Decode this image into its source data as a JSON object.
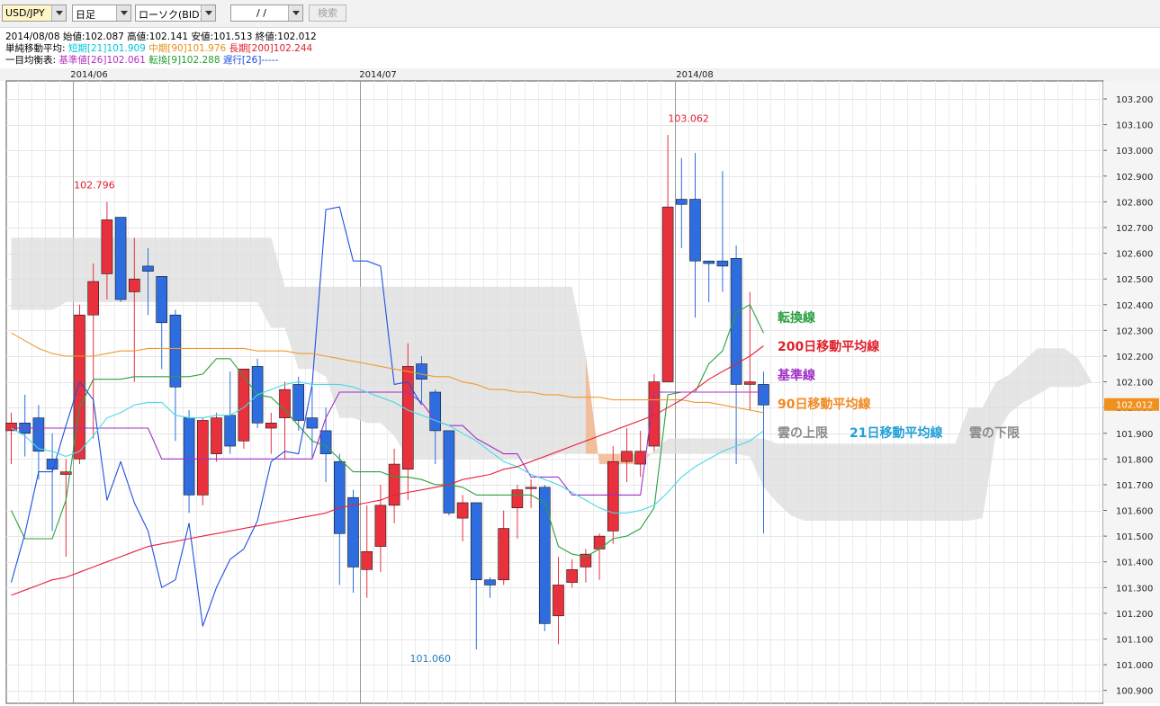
{
  "toolbar": {
    "pair": "USD/JPY",
    "timeframe": "日足",
    "chart_type": "ローソク(BID)",
    "date_input": "/ /",
    "search_label": "検索"
  },
  "info": {
    "ohlc": "2014/08/08  始値:102.087  高値:102.141  安値:101.513  終値:102.012",
    "sma_label": "単純移動平均:",
    "sma_short": "短期[21]101.909",
    "sma_mid": "中期[90]101.976",
    "sma_long": "長期[200]102.244",
    "ichimoku_label": "一目均衡表:",
    "kijun": "基準値[26]102.061",
    "tenkan": "転換[9]102.288",
    "chikou": "遅行[26]-----"
  },
  "legend": {
    "tenkan": "転換線",
    "ma200": "200日移動平均線",
    "kijun": "基準線",
    "ma90": "90日移動平均線",
    "cloud_upper": "雲の上限",
    "ma21": "21日移動平均線",
    "cloud_lower": "雲の下限"
  },
  "colors": {
    "up": "#e8313d",
    "down": "#2d6de0",
    "tenkan": "#2ca040",
    "kijun": "#a030c8",
    "chikou": "#2050e0",
    "ma21": "#4ad8e8",
    "ma90": "#f09a30",
    "ma200": "#e8203c",
    "cloud": "#dcdcdc",
    "cloud_bull": "#f2b48a",
    "last_price_bg": "#f0901e"
  },
  "chart_data": {
    "type": "candlestick",
    "title": "",
    "ylim": [
      100.85,
      103.27
    ],
    "y_ticks": [
      "103.200",
      "103.100",
      "103.000",
      "102.900",
      "102.800",
      "102.700",
      "102.600",
      "102.500",
      "102.400",
      "102.300",
      "102.200",
      "102.100",
      "102.000",
      "101.900",
      "101.800",
      "101.700",
      "101.600",
      "101.500",
      "101.400",
      "101.300",
      "101.200",
      "101.100",
      "101.000",
      "100.900"
    ],
    "x_labels": [
      "2014/06",
      "2014/07",
      "2014/08"
    ],
    "last_price": "102.012",
    "annotations": [
      {
        "label": "102.796",
        "value": 102.796
      },
      {
        "label": "103.062",
        "value": 103.062
      },
      {
        "label": "101.060",
        "value": 101.06
      }
    ],
    "candles": [
      {
        "o": 101.91,
        "h": 101.98,
        "l": 101.78,
        "c": 101.94
      },
      {
        "o": 101.94,
        "h": 102.05,
        "l": 101.81,
        "c": 101.9
      },
      {
        "o": 101.96,
        "h": 102.01,
        "l": 101.72,
        "c": 101.83
      },
      {
        "o": 101.8,
        "h": 101.9,
        "l": 101.52,
        "c": 101.76
      },
      {
        "o": 101.74,
        "h": 101.8,
        "l": 101.42,
        "c": 101.75
      },
      {
        "o": 101.8,
        "h": 102.4,
        "l": 101.78,
        "c": 102.36
      },
      {
        "o": 102.36,
        "h": 102.56,
        "l": 101.88,
        "c": 102.49
      },
      {
        "o": 102.52,
        "h": 102.8,
        "l": 102.42,
        "c": 102.73
      },
      {
        "o": 102.74,
        "h": 102.74,
        "l": 102.41,
        "c": 102.42
      },
      {
        "o": 102.45,
        "h": 102.66,
        "l": 102.1,
        "c": 102.5
      },
      {
        "o": 102.55,
        "h": 102.62,
        "l": 102.36,
        "c": 102.53
      },
      {
        "o": 102.51,
        "h": 102.51,
        "l": 102.15,
        "c": 102.33
      },
      {
        "o": 102.36,
        "h": 102.38,
        "l": 101.87,
        "c": 102.08
      },
      {
        "o": 101.96,
        "h": 101.99,
        "l": 101.59,
        "c": 101.66
      },
      {
        "o": 101.66,
        "h": 101.96,
        "l": 101.62,
        "c": 101.95
      },
      {
        "o": 101.82,
        "h": 101.98,
        "l": 101.79,
        "c": 101.96
      },
      {
        "o": 101.97,
        "h": 102.14,
        "l": 101.82,
        "c": 101.85
      },
      {
        "o": 101.87,
        "h": 102.14,
        "l": 101.84,
        "c": 102.15
      },
      {
        "o": 102.16,
        "h": 102.19,
        "l": 101.92,
        "c": 101.94
      },
      {
        "o": 101.92,
        "h": 101.98,
        "l": 101.82,
        "c": 101.94
      },
      {
        "o": 101.96,
        "h": 102.1,
        "l": 101.8,
        "c": 102.07
      },
      {
        "o": 102.09,
        "h": 102.12,
        "l": 101.91,
        "c": 101.95
      },
      {
        "o": 101.96,
        "h": 102.08,
        "l": 101.8,
        "c": 101.92
      },
      {
        "o": 101.91,
        "h": 102.0,
        "l": 101.71,
        "c": 101.82
      },
      {
        "o": 101.79,
        "h": 101.82,
        "l": 101.31,
        "c": 101.51
      },
      {
        "o": 101.65,
        "h": 101.68,
        "l": 101.28,
        "c": 101.38
      },
      {
        "o": 101.37,
        "h": 101.62,
        "l": 101.26,
        "c": 101.44
      },
      {
        "o": 101.46,
        "h": 101.7,
        "l": 101.36,
        "c": 101.62
      },
      {
        "o": 101.62,
        "h": 101.84,
        "l": 101.55,
        "c": 101.78
      },
      {
        "o": 101.76,
        "h": 102.25,
        "l": 101.64,
        "c": 102.16
      },
      {
        "o": 102.17,
        "h": 102.2,
        "l": 102.02,
        "c": 102.11
      },
      {
        "o": 102.06,
        "h": 102.07,
        "l": 101.78,
        "c": 101.91
      },
      {
        "o": 101.91,
        "h": 101.91,
        "l": 101.58,
        "c": 101.59
      },
      {
        "o": 101.57,
        "h": 101.66,
        "l": 101.48,
        "c": 101.63
      },
      {
        "o": 101.63,
        "h": 101.62,
        "l": 101.06,
        "c": 101.33
      },
      {
        "o": 101.33,
        "h": 101.34,
        "l": 101.26,
        "c": 101.31
      },
      {
        "o": 101.33,
        "h": 101.6,
        "l": 101.31,
        "c": 101.53
      },
      {
        "o": 101.61,
        "h": 101.7,
        "l": 101.49,
        "c": 101.68
      },
      {
        "o": 101.69,
        "h": 101.72,
        "l": 101.61,
        "c": 101.69
      },
      {
        "o": 101.69,
        "h": 101.7,
        "l": 101.13,
        "c": 101.16
      },
      {
        "o": 101.19,
        "h": 101.42,
        "l": 101.08,
        "c": 101.31
      },
      {
        "o": 101.32,
        "h": 101.41,
        "l": 101.3,
        "c": 101.37
      },
      {
        "o": 101.38,
        "h": 101.45,
        "l": 101.32,
        "c": 101.43
      },
      {
        "o": 101.45,
        "h": 101.51,
        "l": 101.33,
        "c": 101.5
      },
      {
        "o": 101.52,
        "h": 101.85,
        "l": 101.47,
        "c": 101.79
      },
      {
        "o": 101.79,
        "h": 101.92,
        "l": 101.71,
        "c": 101.83
      },
      {
        "o": 101.78,
        "h": 101.91,
        "l": 101.73,
        "c": 101.83
      },
      {
        "o": 101.85,
        "h": 102.13,
        "l": 101.83,
        "c": 102.1
      },
      {
        "o": 102.1,
        "h": 103.06,
        "l": 102.1,
        "c": 102.78
      },
      {
        "o": 102.81,
        "h": 102.97,
        "l": 102.62,
        "c": 102.79
      },
      {
        "o": 102.81,
        "h": 102.99,
        "l": 102.35,
        "c": 102.57
      },
      {
        "o": 102.57,
        "h": 102.57,
        "l": 102.41,
        "c": 102.56
      },
      {
        "o": 102.57,
        "h": 102.92,
        "l": 102.45,
        "c": 102.55
      },
      {
        "o": 102.58,
        "h": 102.63,
        "l": 101.78,
        "c": 102.09
      },
      {
        "o": 102.09,
        "h": 102.45,
        "l": 101.99,
        "c": 102.1
      },
      {
        "o": 102.09,
        "h": 102.14,
        "l": 101.51,
        "c": 102.01
      }
    ],
    "series": [
      {
        "name": "転換線",
        "values": [
          101.6,
          101.49,
          101.49,
          101.49,
          101.64,
          102.0,
          102.11,
          102.11,
          102.11,
          102.12,
          102.12,
          102.12,
          102.12,
          102.12,
          102.13,
          102.19,
          102.19,
          102.12,
          102.05,
          102.04,
          101.99,
          101.93,
          101.87,
          101.85,
          101.8,
          101.75,
          101.75,
          101.75,
          101.73,
          101.73,
          101.72,
          101.7,
          101.7,
          101.69,
          101.66,
          101.66,
          101.66,
          101.66,
          101.66,
          101.63,
          101.46,
          101.43,
          101.42,
          101.45,
          101.49,
          101.5,
          101.53,
          101.61,
          102.05,
          102.06,
          102.06,
          102.17,
          102.22,
          102.37,
          102.4,
          102.29
        ]
      },
      {
        "name": "基準線",
        "values": [
          101.92,
          101.92,
          101.92,
          101.92,
          101.92,
          101.92,
          101.92,
          101.92,
          101.92,
          101.92,
          101.92,
          101.8,
          101.8,
          101.8,
          101.8,
          101.8,
          101.8,
          101.8,
          101.8,
          101.8,
          101.8,
          101.8,
          101.8,
          101.96,
          102.06,
          102.06,
          102.06,
          102.06,
          102.06,
          102.06,
          102.02,
          101.95,
          101.93,
          101.93,
          101.88,
          101.85,
          101.82,
          101.82,
          101.73,
          101.73,
          101.73,
          101.66,
          101.66,
          101.66,
          101.66,
          101.66,
          101.66,
          102.06,
          102.06,
          102.06,
          102.06,
          102.06,
          102.06,
          102.06,
          102.06,
          102.06
        ]
      },
      {
        "name": "遅行線",
        "values": [
          101.32,
          101.51,
          101.75,
          101.75,
          101.93,
          102.1,
          102.03,
          101.64,
          101.79,
          101.63,
          101.52,
          101.3,
          101.33,
          101.55,
          101.15,
          101.3,
          101.41,
          101.45,
          101.56,
          101.79,
          101.83,
          101.82,
          102.09,
          102.77,
          102.78,
          102.57,
          102.57,
          102.55,
          102.09,
          102.1,
          102.01
        ]
      },
      {
        "name": "21日移動平均線",
        "values": [
          101.92,
          101.89,
          101.84,
          101.83,
          101.81,
          101.83,
          101.89,
          101.96,
          101.98,
          102.01,
          102.02,
          102.02,
          101.97,
          101.96,
          101.96,
          101.97,
          101.97,
          102.0,
          102.05,
          102.07,
          102.09,
          102.1,
          102.09,
          102.09,
          102.09,
          102.08,
          102.06,
          102.04,
          102.02,
          101.99,
          101.97,
          101.95,
          101.93,
          101.9,
          101.87,
          101.83,
          101.79,
          101.77,
          101.74,
          101.72,
          101.7,
          101.67,
          101.64,
          101.61,
          101.59,
          101.59,
          101.6,
          101.62,
          101.67,
          101.73,
          101.77,
          101.8,
          101.83,
          101.85,
          101.87,
          101.91
        ]
      },
      {
        "name": "90日移動平均線",
        "values": [
          102.29,
          102.26,
          102.23,
          102.21,
          102.2,
          102.2,
          102.2,
          102.21,
          102.22,
          102.22,
          102.23,
          102.23,
          102.23,
          102.23,
          102.23,
          102.23,
          102.23,
          102.23,
          102.22,
          102.22,
          102.22,
          102.21,
          102.21,
          102.2,
          102.19,
          102.18,
          102.17,
          102.16,
          102.15,
          102.14,
          102.13,
          102.12,
          102.12,
          102.1,
          102.09,
          102.07,
          102.07,
          102.06,
          102.06,
          102.05,
          102.05,
          102.04,
          102.04,
          102.04,
          102.03,
          102.03,
          102.03,
          102.03,
          102.03,
          102.03,
          102.02,
          102.02,
          102.01,
          102.0,
          101.99,
          101.98
        ]
      },
      {
        "name": "200日移動平均線",
        "values": [
          101.27,
          101.29,
          101.31,
          101.33,
          101.34,
          101.36,
          101.38,
          101.4,
          101.42,
          101.44,
          101.46,
          101.47,
          101.48,
          101.49,
          101.5,
          101.51,
          101.52,
          101.53,
          101.54,
          101.55,
          101.56,
          101.57,
          101.58,
          101.59,
          101.61,
          101.62,
          101.63,
          101.64,
          101.66,
          101.67,
          101.68,
          101.69,
          101.7,
          101.72,
          101.73,
          101.74,
          101.76,
          101.77,
          101.79,
          101.81,
          101.83,
          101.85,
          101.87,
          101.89,
          101.91,
          101.93,
          101.95,
          101.97,
          102.0,
          102.03,
          102.07,
          102.11,
          102.14,
          102.17,
          102.2,
          102.24
        ]
      }
    ],
    "cloud": {
      "upper": [
        102.66,
        102.66,
        102.66,
        102.66,
        102.66,
        102.66,
        102.66,
        102.66,
        102.66,
        102.66,
        102.66,
        102.66,
        102.66,
        102.66,
        102.66,
        102.66,
        102.66,
        102.66,
        102.66,
        102.66,
        102.47,
        102.47,
        102.47,
        102.47,
        102.47,
        102.47,
        102.47,
        102.47,
        102.47,
        102.47,
        102.47,
        102.47,
        102.47,
        102.47,
        102.47,
        102.47,
        102.47,
        102.47,
        102.47,
        102.47,
        102.47,
        102.47,
        102.2,
        101.78,
        101.78,
        101.78,
        101.78,
        101.83,
        101.88,
        101.88,
        101.88,
        101.88,
        101.88,
        101.88,
        101.88,
        101.88,
        101.86,
        101.86,
        101.86,
        101.86,
        101.86,
        101.86,
        101.86,
        101.86,
        101.86,
        101.86,
        101.86,
        101.86,
        101.86,
        101.86,
        102.0,
        102.0,
        102.1,
        102.13,
        102.18,
        102.23,
        102.23,
        102.23,
        102.19,
        102.1
      ],
      "lower": [
        102.38,
        102.38,
        102.38,
        102.38,
        102.41,
        102.41,
        102.41,
        102.41,
        102.41,
        102.41,
        102.41,
        102.41,
        102.41,
        102.41,
        102.41,
        102.41,
        102.41,
        102.41,
        102.41,
        102.31,
        102.31,
        102.15,
        102.15,
        102.12,
        101.96,
        101.96,
        101.94,
        101.94,
        101.89,
        101.8,
        101.8,
        101.8,
        101.8,
        101.8,
        101.8,
        101.8,
        101.8,
        101.8,
        101.8,
        101.8,
        101.82,
        101.82,
        101.82,
        101.82,
        101.82,
        101.82,
        101.82,
        101.82,
        101.82,
        101.82,
        101.82,
        101.82,
        101.82,
        101.82,
        101.81,
        101.69,
        101.63,
        101.58,
        101.56,
        101.56,
        101.56,
        101.56,
        101.56,
        101.56,
        101.56,
        101.56,
        101.56,
        101.56,
        101.56,
        101.56,
        101.56,
        101.57,
        101.9,
        101.98,
        102.02,
        102.05,
        102.08,
        102.08,
        102.08,
        102.1
      ]
    }
  }
}
